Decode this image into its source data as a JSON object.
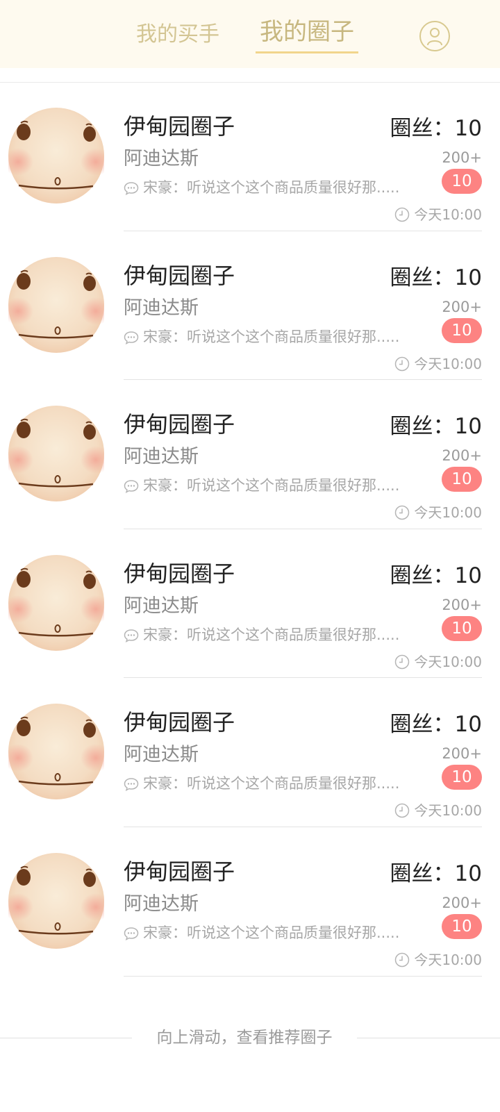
{
  "header": {
    "tabs": [
      {
        "label": "我的买手",
        "active": false
      },
      {
        "label": "我的圈子",
        "active": true
      }
    ],
    "user_icon": "user-circle-icon"
  },
  "colors": {
    "header_bg": "#fefaef",
    "tab_text": "#cfc08d",
    "tab_underline": "#f1d58c",
    "badge_bg": "#fd8382"
  },
  "circles": [
    {
      "name": "伊甸园圈子",
      "brand": "阿迪达斯",
      "last_message": "宋豪：听说这个这个商品质量很好那.....",
      "fans": "圈丝：10",
      "count": "200+",
      "badge": "10",
      "time": "今天10:00"
    },
    {
      "name": "伊甸园圈子",
      "brand": "阿迪达斯",
      "last_message": "宋豪：听说这个这个商品质量很好那.....",
      "fans": "圈丝：10",
      "count": "200+",
      "badge": "10",
      "time": "今天10:00"
    },
    {
      "name": "伊甸园圈子",
      "brand": "阿迪达斯",
      "last_message": "宋豪：听说这个这个商品质量很好那.....",
      "fans": "圈丝：10",
      "count": "200+",
      "badge": "10",
      "time": "今天10:00"
    },
    {
      "name": "伊甸园圈子",
      "brand": "阿迪达斯",
      "last_message": "宋豪：听说这个这个商品质量很好那.....",
      "fans": "圈丝：10",
      "count": "200+",
      "badge": "10",
      "time": "今天10:00"
    },
    {
      "name": "伊甸园圈子",
      "brand": "阿迪达斯",
      "last_message": "宋豪：听说这个这个商品质量很好那.....",
      "fans": "圈丝：10",
      "count": "200+",
      "badge": "10",
      "time": "今天10:00"
    },
    {
      "name": "伊甸园圈子",
      "brand": "阿迪达斯",
      "last_message": "宋豪：听说这个这个商品质量很好那.....",
      "fans": "圈丝：10",
      "count": "200+",
      "badge": "10",
      "time": "今天10:00"
    }
  ],
  "footer": {
    "hint": "向上滑动，查看推荐圈子"
  }
}
